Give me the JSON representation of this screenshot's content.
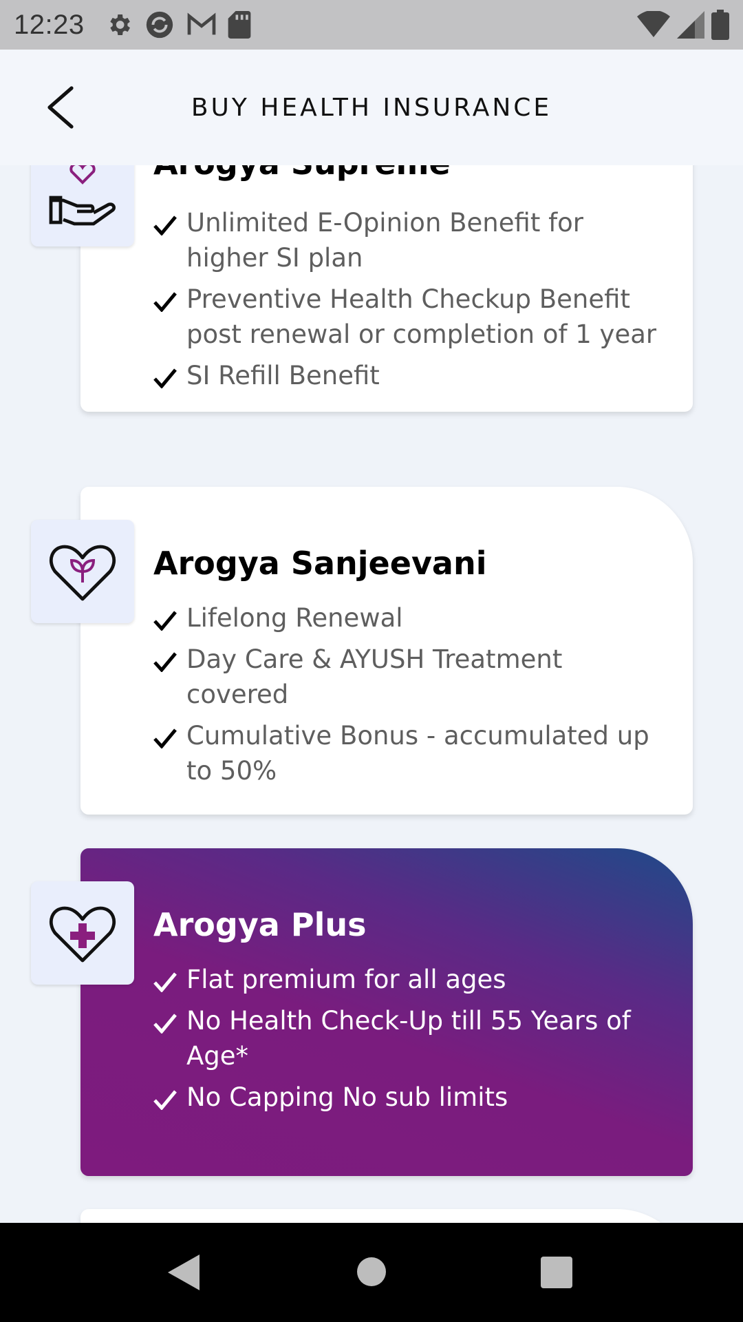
{
  "status_bar": {
    "time": "12:23",
    "icons": [
      "gear-icon",
      "sync-icon",
      "gmail-icon",
      "sd-card-icon",
      "wifi-icon",
      "signal-icon",
      "battery-icon"
    ]
  },
  "header": {
    "title": "BUY HEALTH INSURANCE",
    "back_icon": "chevron-left-icon"
  },
  "plans": [
    {
      "name": "Arogya Supreme",
      "icon": "hand-heart-icon",
      "features": [
        "Unlimited E-Opinion Benefit for higher SI plan",
        "Preventive Health Checkup Benefit post renewal or completion of 1 year",
        "SI Refill Benefit"
      ]
    },
    {
      "name": "Arogya Sanjeevani",
      "icon": "heart-sprout-icon",
      "features": [
        "Lifelong Renewal",
        "Day Care & AYUSH Treatment covered",
        "Cumulative Bonus - accumulated up to 50%"
      ]
    },
    {
      "name": "Arogya Plus",
      "icon": "heart-cross-icon",
      "features": [
        "Flat premium for all ages",
        "No Health Check-Up till 55 Years of Age*",
        "No Capping No sub limits"
      ]
    }
  ],
  "colors": {
    "background": "#eff3f9",
    "purple_start": "#7e1b7e",
    "purple_end": "#1f4a88",
    "icon_box": "#e9eefc"
  },
  "nav_bar": {
    "icons": [
      "back-triangle-icon",
      "home-circle-icon",
      "recents-square-icon"
    ]
  }
}
